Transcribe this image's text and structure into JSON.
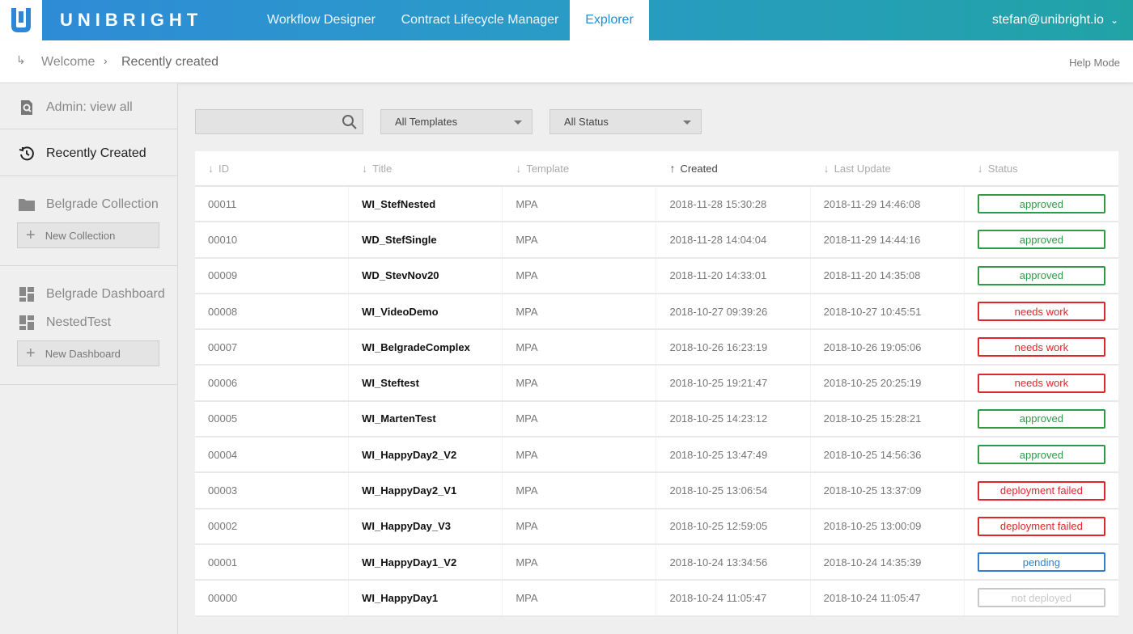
{
  "brand": {
    "name": "UNIBRIGHT",
    "logo_icon": "unibright-logo"
  },
  "nav": {
    "tabs": [
      {
        "label": "Workflow Designer",
        "active": false
      },
      {
        "label": "Contract Lifecycle Manager",
        "active": false
      },
      {
        "label": "Explorer",
        "active": true
      }
    ],
    "user": "stefan@unibright.io"
  },
  "breadcrumb": {
    "items": [
      "Welcome",
      "Recently created"
    ],
    "help": "Help Mode"
  },
  "sidebar": {
    "admin": "Admin: view all",
    "recent": "Recently Created",
    "collection": "Belgrade Collection",
    "new_collection": "New Collection",
    "dashboards": [
      "Belgrade Dashboard",
      "NestedTest"
    ],
    "new_dashboard": "New Dashboard"
  },
  "filters": {
    "search_placeholder": "",
    "template": "All Templates",
    "status": "All Status"
  },
  "table": {
    "columns": [
      "ID",
      "Title",
      "Template",
      "Created",
      "Last Update",
      "Status"
    ],
    "sorted_column": "Created",
    "rows": [
      {
        "id": "00011",
        "title": "WI_StefNested",
        "template": "MPA",
        "created": "2018-11-28 15:30:28",
        "updated": "2018-11-29 14:46:08",
        "status": "approved"
      },
      {
        "id": "00010",
        "title": "WD_StefSingle",
        "template": "MPA",
        "created": "2018-11-28 14:04:04",
        "updated": "2018-11-29 14:44:16",
        "status": "approved"
      },
      {
        "id": "00009",
        "title": "WD_StevNov20",
        "template": "MPA",
        "created": "2018-11-20 14:33:01",
        "updated": "2018-11-20 14:35:08",
        "status": "approved"
      },
      {
        "id": "00008",
        "title": "WI_VideoDemo",
        "template": "MPA",
        "created": "2018-10-27 09:39:26",
        "updated": "2018-10-27 10:45:51",
        "status": "needs work"
      },
      {
        "id": "00007",
        "title": "WI_BelgradeComplex",
        "template": "MPA",
        "created": "2018-10-26 16:23:19",
        "updated": "2018-10-26 19:05:06",
        "status": "needs work"
      },
      {
        "id": "00006",
        "title": "WI_Steftest",
        "template": "MPA",
        "created": "2018-10-25 19:21:47",
        "updated": "2018-10-25 20:25:19",
        "status": "needs work"
      },
      {
        "id": "00005",
        "title": "WI_MartenTest",
        "template": "MPA",
        "created": "2018-10-25 14:23:12",
        "updated": "2018-10-25 15:28:21",
        "status": "approved"
      },
      {
        "id": "00004",
        "title": "WI_HappyDay2_V2",
        "template": "MPA",
        "created": "2018-10-25 13:47:49",
        "updated": "2018-10-25 14:56:36",
        "status": "approved"
      },
      {
        "id": "00003",
        "title": "WI_HappyDay2_V1",
        "template": "MPA",
        "created": "2018-10-25 13:06:54",
        "updated": "2018-10-25 13:37:09",
        "status": "deployment failed"
      },
      {
        "id": "00002",
        "title": "WI_HappyDay_V3",
        "template": "MPA",
        "created": "2018-10-25 12:59:05",
        "updated": "2018-10-25 13:00:09",
        "status": "deployment failed"
      },
      {
        "id": "00001",
        "title": "WI_HappyDay1_V2",
        "template": "MPA",
        "created": "2018-10-24 13:34:56",
        "updated": "2018-10-24 14:35:39",
        "status": "pending"
      },
      {
        "id": "00000",
        "title": "WI_HappyDay1",
        "template": "MPA",
        "created": "2018-10-24 11:05:47",
        "updated": "2018-10-24 11:05:47",
        "status": "not deployed"
      }
    ]
  },
  "status_colors": {
    "approved": "#2e9a48",
    "needs work": "#e0262b",
    "deployment failed": "#e0262b",
    "pending": "#2f7fd1",
    "not deployed": "#c8c8c8"
  }
}
